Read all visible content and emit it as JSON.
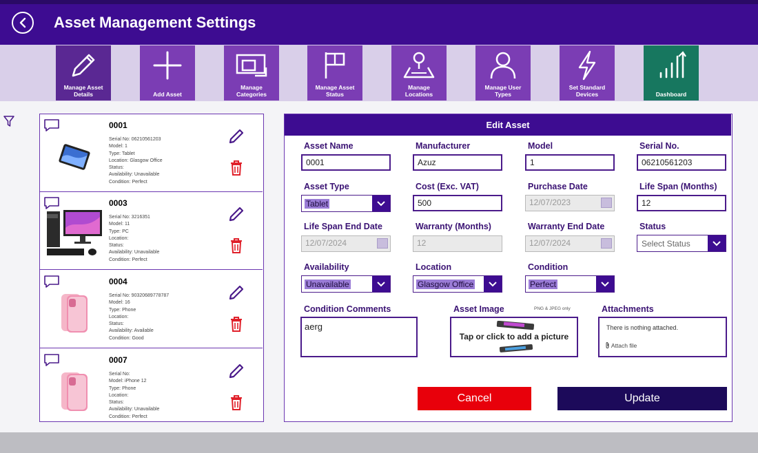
{
  "app": {
    "title": "Asset Management Settings"
  },
  "toolbar": [
    {
      "label": "Manage Asset\nDetails",
      "icon": "pencil-icon"
    },
    {
      "label": "Add Asset",
      "icon": "plus-icon"
    },
    {
      "label": "Manage\nCategories",
      "icon": "categories-icon"
    },
    {
      "label": "Manage Asset\nStatus",
      "icon": "flag-icon"
    },
    {
      "label": "Manage\nLocations",
      "icon": "map-pin-icon"
    },
    {
      "label": "Manage User\nTypes",
      "icon": "user-icon"
    },
    {
      "label": "Set Standard\nDevices",
      "icon": "lightning-icon"
    },
    {
      "label": "Dashboard",
      "icon": "chart-icon"
    }
  ],
  "assets": [
    {
      "id": "0001",
      "lines": [
        "Serial No: 06210561203",
        "Model: 1",
        "Type: Tablet",
        "Location: Glasgow Office",
        "Status:",
        "Availability: Unavailable",
        "Condition: Perfect"
      ]
    },
    {
      "id": "0003",
      "lines": [
        "Serial No: 3216351",
        "Model: 11",
        "Type: PC",
        "Location:",
        "Status:",
        "Availability: Unavailable",
        "Condition: Perfect"
      ]
    },
    {
      "id": "0004",
      "lines": [
        "Serial No: 90320689778787",
        "Model: 16",
        "Type: Phone",
        "Location:",
        "Status:",
        "Availability: Available",
        "Condition: Good"
      ]
    },
    {
      "id": "0007",
      "lines": [
        "Serial No:",
        "Model: iPhone 12",
        "Type: Phone",
        "Location:",
        "Status:",
        "Availability: Unavailable",
        "Condition: Perfect"
      ]
    }
  ],
  "form": {
    "header": "Edit Asset",
    "asset_name": {
      "label": "Asset Name",
      "value": "0001"
    },
    "manufacturer": {
      "label": "Manufacturer",
      "value": "Azuz"
    },
    "model": {
      "label": "Model",
      "value": "1"
    },
    "serial": {
      "label": "Serial No.",
      "value": "06210561203"
    },
    "asset_type": {
      "label": "Asset Type",
      "value": "Tablet"
    },
    "cost": {
      "label": "Cost (Exc. VAT)",
      "value": "500"
    },
    "purchase_date": {
      "label": "Purchase Date",
      "value": "12/07/2023"
    },
    "life_span": {
      "label": "Life Span (Months)",
      "value": "12"
    },
    "life_span_end": {
      "label": "Life Span End Date",
      "value": "12/07/2024"
    },
    "warranty": {
      "label": "Warranty (Months)",
      "value": "12"
    },
    "warranty_end": {
      "label": "Warranty End Date",
      "value": "12/07/2024"
    },
    "status": {
      "label": "Status",
      "placeholder": "Select Status"
    },
    "availability": {
      "label": "Availability",
      "value": "Unavailable"
    },
    "location": {
      "label": "Location",
      "value": "Glasgow Office"
    },
    "condition": {
      "label": "Condition",
      "value": "Perfect"
    },
    "condition_comments": {
      "label": "Condition Comments",
      "value": "aerg"
    },
    "asset_image": {
      "label": "Asset Image",
      "hint": "PNG & JPEG only",
      "prompt": "Tap or click to add a picture"
    },
    "attachments": {
      "label": "Attachments",
      "empty": "There is nothing attached.",
      "attach": "Attach file"
    },
    "cancel": "Cancel",
    "update": "Update"
  },
  "colors": {
    "header": "#3d0c91",
    "tile": "#7b3db4",
    "dashboard_tile": "#17775f",
    "cancel": "#e8000b",
    "update": "#1c0a5a",
    "delete": "#e0202a"
  }
}
